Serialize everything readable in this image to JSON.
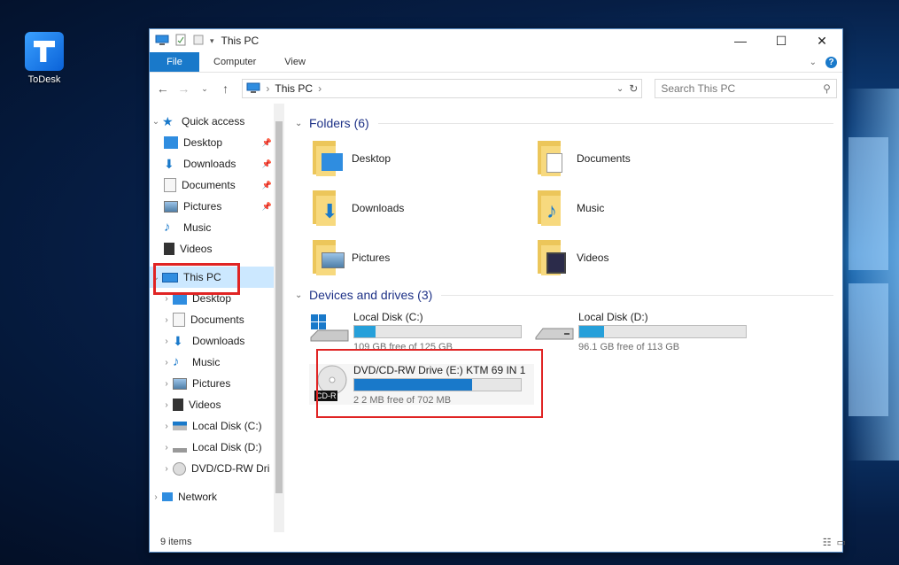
{
  "desktop": {
    "icon_label": "ToDesk"
  },
  "window": {
    "title": "This PC",
    "ribbon": {
      "file": "File",
      "tabs": [
        "Computer",
        "View"
      ]
    },
    "address": {
      "path": "This PC"
    },
    "search": {
      "placeholder": "Search This PC"
    }
  },
  "nav": {
    "quick_access": "Quick access",
    "quick_items": [
      "Desktop",
      "Downloads",
      "Documents",
      "Pictures",
      "Music",
      "Videos"
    ],
    "this_pc": "This PC",
    "pc_items": [
      "Desktop",
      "Documents",
      "Downloads",
      "Music",
      "Pictures",
      "Videos",
      "Local Disk (C:)",
      "Local Disk (D:)",
      "DVD/CD-RW Dri"
    ],
    "network": "Network"
  },
  "content": {
    "folders_header": "Folders (6)",
    "folders": [
      "Desktop",
      "Documents",
      "Downloads",
      "Music",
      "Pictures",
      "Videos"
    ],
    "drives_header": "Devices and drives (3)",
    "drives": [
      {
        "name": "Local Disk (C:)",
        "free": "109 GB free of 125 GB",
        "used_fraction": 0.13
      },
      {
        "name": "Local Disk (D:)",
        "free": "96.1 GB free of 113 GB",
        "used_fraction": 0.15
      },
      {
        "name": "DVD/CD-RW Drive (E:) KTM 69 IN 1",
        "free": "2 2 MB free of 702 MB",
        "used_fraction": 0.71,
        "badge": "CD-R"
      }
    ]
  },
  "status": {
    "items": "9 items"
  },
  "colors": {
    "accent": "#1979ca",
    "bar_fill": "#26a0da",
    "highlight": "#e02424",
    "selection": "#cce8ff"
  }
}
